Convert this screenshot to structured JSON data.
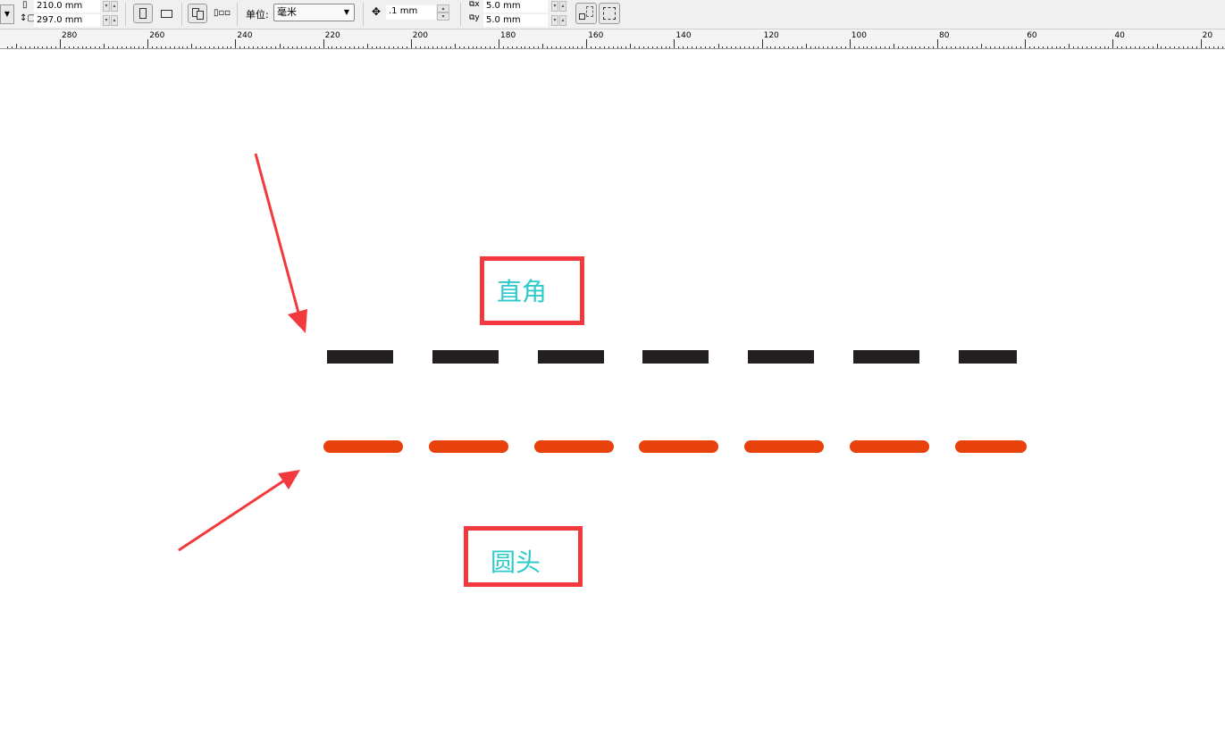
{
  "toolbar": {
    "page_width": "210.0 mm",
    "page_height": "297.0 mm",
    "units_label": "单位:",
    "units_value": "毫米",
    "nudge": ".1 mm",
    "dup_x": "5.0 mm",
    "dup_y": "5.0 mm"
  },
  "ruler": {
    "labels": [
      "280",
      "260",
      "240",
      "220",
      "200",
      "180",
      "160",
      "140",
      "120",
      "100",
      "80",
      "60",
      "40",
      "20"
    ]
  },
  "canvas": {
    "square_label": "直角",
    "round_label": "圆头",
    "square_dash_color": "#231f20",
    "round_dash_color": "#e8410b",
    "box_color": "#f23a3e",
    "label_color": "#2ec9c9",
    "dash_count": 7
  }
}
